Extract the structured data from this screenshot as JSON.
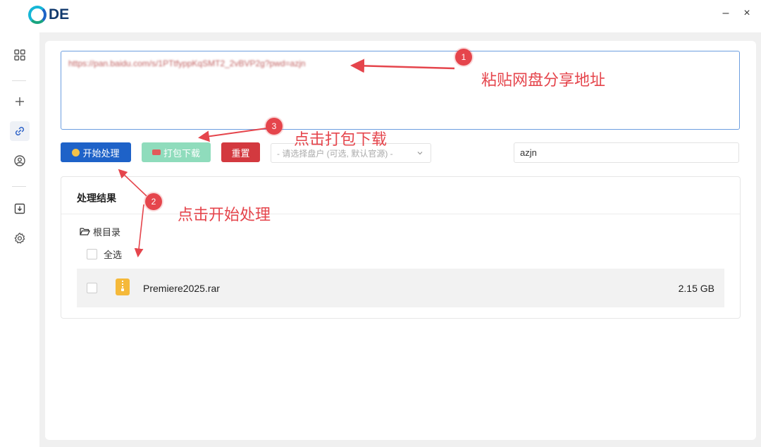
{
  "app": {
    "logo_text": "DE",
    "minimize": "–",
    "close": "×"
  },
  "sidebar": {
    "items": [
      {
        "name": "apps-icon",
        "active": false
      },
      {
        "name": "plus-icon",
        "active": false
      },
      {
        "name": "link-icon",
        "active": true
      },
      {
        "name": "user-circle-icon",
        "active": false
      },
      {
        "name": "download-icon",
        "active": false
      },
      {
        "name": "gear-icon",
        "active": false
      }
    ]
  },
  "input": {
    "url": "https://pan.baidu.com/s/1PTtfyppKqSMT2_2vBVP2g?pwd=azjn"
  },
  "toolbar": {
    "start_label": "开始处理",
    "pack_label": "打包下载",
    "reset_label": "重置",
    "disk_placeholder": "- 请选择盘户 (可选, 默认官源) -",
    "password_value": "azjn"
  },
  "result": {
    "title": "处理结果",
    "root_label": "根目录",
    "select_all_label": "全选",
    "files": [
      {
        "name": "Premiere2025.rar",
        "size": "2.15 GB"
      }
    ]
  },
  "annotations": [
    {
      "number": "1",
      "text": "粘贴网盘分享地址"
    },
    {
      "number": "2",
      "text": "点击开始处理"
    },
    {
      "number": "3",
      "text": "点击打包下载"
    }
  ],
  "colors": {
    "accent": "#1e62c8",
    "annotation": "#e5454c",
    "pack": "#8fdcbc",
    "reset": "#d3393f"
  }
}
